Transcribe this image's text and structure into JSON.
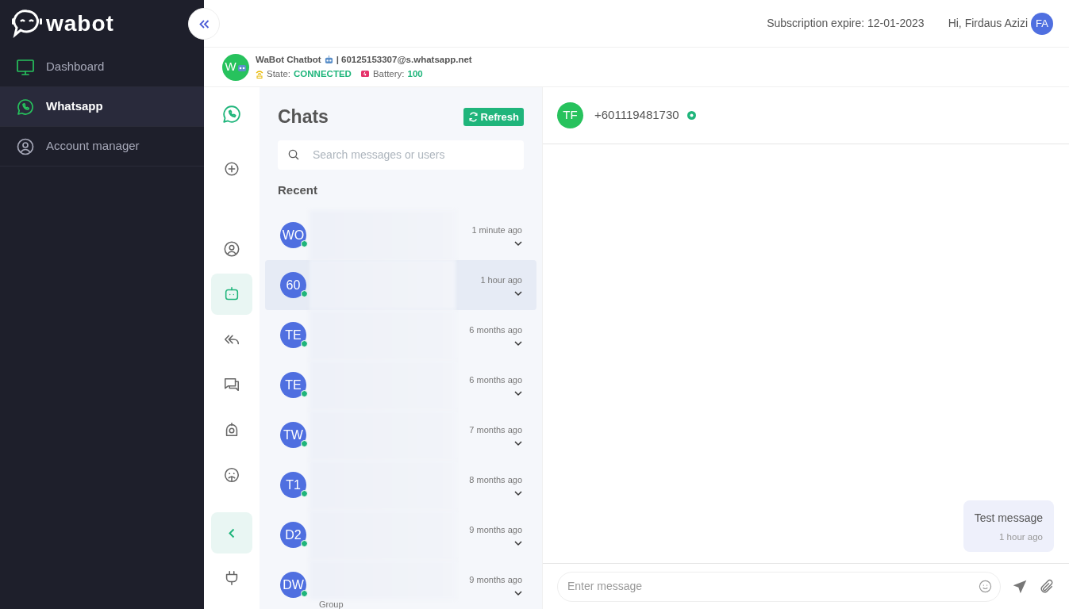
{
  "brand": {
    "name": "wabot"
  },
  "sidebar": {
    "items": [
      {
        "kind": "monitor",
        "label": "Dashboard",
        "selected": false
      },
      {
        "kind": "whatsapp",
        "label": "Whatsapp",
        "selected": true
      },
      {
        "kind": "user",
        "label": "Account manager",
        "selected": false
      }
    ]
  },
  "header": {
    "subscription": "Subscription expire: 12-01-2023",
    "greeting": "Hi, Firdaus Azizi",
    "avatar": "FA"
  },
  "device": {
    "avatar": "W",
    "name": "WaBot Chatbot",
    "number": "| 60125153307@s.whatsapp.net",
    "state_label": "State:",
    "state": "CONNECTED",
    "battery_label": "Battery:",
    "battery": "100"
  },
  "rail": [
    {
      "kind": "whatsapp",
      "selected": false
    },
    {
      "kind": "plus",
      "selected": false
    },
    {
      "kind": "user",
      "selected": false
    },
    {
      "kind": "bot",
      "selected": true
    },
    {
      "kind": "reply-all",
      "selected": false
    },
    {
      "kind": "chat",
      "selected": false
    },
    {
      "kind": "robot",
      "selected": false
    },
    {
      "kind": "emoji",
      "selected": false
    },
    {
      "kind": "collapse"
    },
    {
      "kind": "plug",
      "selected": false
    }
  ],
  "chats": {
    "title": "Chats",
    "refresh": "Refresh",
    "search": {
      "placeholder": "Search messages or users"
    },
    "section": "Recent",
    "items": [
      {
        "initials": "WO",
        "time": "1 minute ago",
        "online": true,
        "selected": false
      },
      {
        "initials": "60",
        "time": "1 hour ago",
        "online": true,
        "selected": true
      },
      {
        "initials": "TE",
        "time": "6 months ago",
        "online": true,
        "selected": false
      },
      {
        "initials": "TE",
        "time": "6 months ago",
        "online": true,
        "selected": false
      },
      {
        "initials": "TW",
        "time": "7 months ago",
        "online": true,
        "selected": false
      },
      {
        "initials": "T1",
        "time": "8 months ago",
        "online": true,
        "selected": false
      },
      {
        "initials": "D2",
        "time": "9 months ago",
        "online": true,
        "selected": false
      },
      {
        "initials": "DW",
        "time": "9 months ago",
        "online": true,
        "selected": false,
        "subtitle": "Group"
      }
    ]
  },
  "conversation": {
    "avatar": "TF",
    "contact": "+601119481730",
    "online": true,
    "messages": [
      {
        "text": "Test message",
        "time": "1 hour ago",
        "outgoing": true
      }
    ],
    "input": {
      "placeholder": "Enter message"
    }
  }
}
